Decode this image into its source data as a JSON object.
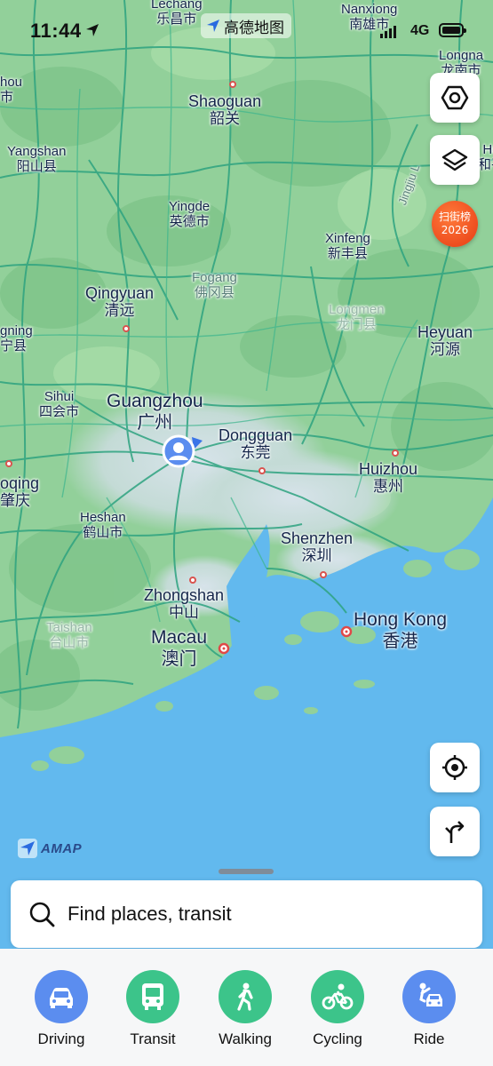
{
  "status": {
    "time": "11:44",
    "network": "4G"
  },
  "app_badge": "高德地图",
  "map": {
    "places": [
      {
        "id": "lechang",
        "en": "Lechang",
        "zh": "乐昌市"
      },
      {
        "id": "nanxiong",
        "en": "Nanxiong",
        "zh": "南雄市"
      },
      {
        "id": "longnan",
        "en": "Longna",
        "zh": "龙南市"
      },
      {
        "id": "left-top",
        "en": "hou",
        "zh": "市"
      },
      {
        "id": "shaoguan",
        "en": "Shaoguan",
        "zh": "韶关"
      },
      {
        "id": "yangshan",
        "en": "Yangshan",
        "zh": "阳山县"
      },
      {
        "id": "right-edge",
        "en": "He",
        "zh": "和平"
      },
      {
        "id": "yingde",
        "en": "Yingde",
        "zh": "英德市"
      },
      {
        "id": "xinfeng",
        "en": "Xinfeng",
        "zh": "新丰县"
      },
      {
        "id": "fogang",
        "en": "Fogang",
        "zh": "佛冈县"
      },
      {
        "id": "qingyuan",
        "en": "Qingyuan",
        "zh": "清远"
      },
      {
        "id": "longmen",
        "en": "Longmen",
        "zh": "龙门县"
      },
      {
        "id": "heyuan",
        "en": "Heyuan",
        "zh": "河源"
      },
      {
        "id": "guangning",
        "en": "gning",
        "zh": "宁县"
      },
      {
        "id": "sihui",
        "en": "Sihui",
        "zh": "四会市"
      },
      {
        "id": "guangzhou",
        "en": "Guangzhou",
        "zh": "广州"
      },
      {
        "id": "dongguan",
        "en": "Dongguan",
        "zh": "东莞"
      },
      {
        "id": "huizhou",
        "en": "Huizhou",
        "zh": "惠州"
      },
      {
        "id": "zhaoqing",
        "en": "oqing",
        "zh": "肇庆"
      },
      {
        "id": "heshan",
        "en": "Heshan",
        "zh": "鹤山市"
      },
      {
        "id": "shenzhen",
        "en": "Shenzhen",
        "zh": "深圳"
      },
      {
        "id": "zhongshan",
        "en": "Zhongshan",
        "zh": "中山"
      },
      {
        "id": "taishan",
        "en": "Taishan",
        "zh": "台山市"
      },
      {
        "id": "macau",
        "en": "Macau",
        "zh": "澳门"
      },
      {
        "id": "hongkong",
        "en": "Hong Kong",
        "zh": "香港"
      }
    ],
    "mountain_label": "Jingjiu L",
    "promo": {
      "line1": "扫街榜",
      "line2": "2026"
    },
    "attribution": "AMAP"
  },
  "search": {
    "placeholder": "Find places, transit"
  },
  "modes": [
    {
      "label": "Driving",
      "color": "#5b8def"
    },
    {
      "label": "Transit",
      "color": "#3cc48a"
    },
    {
      "label": "Walking",
      "color": "#3cc48a"
    },
    {
      "label": "Cycling",
      "color": "#3cc48a"
    },
    {
      "label": "Ride",
      "color": "#5b8def"
    }
  ]
}
